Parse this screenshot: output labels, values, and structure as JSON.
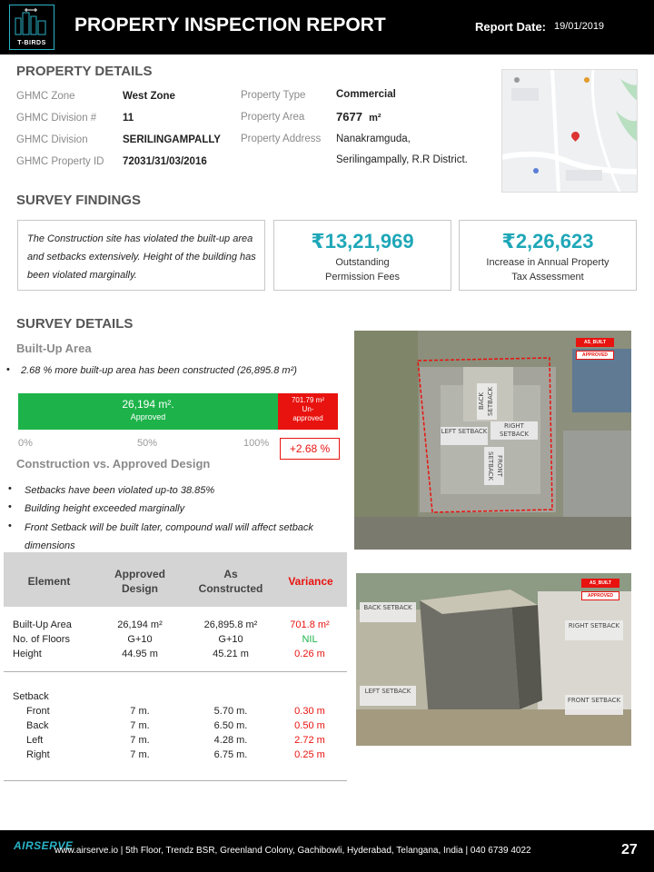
{
  "header": {
    "logo_text": "T-BIRDS",
    "title": "PROPERTY INSPECTION REPORT",
    "report_date_label": "Report Date:",
    "report_date": "19/01/2019"
  },
  "property_details": {
    "title": "PROPERTY DETAILS",
    "ghmc_zone_label": "GHMC Zone",
    "ghmc_zone": "West Zone",
    "ghmc_division_no_label": "GHMC Division  #",
    "ghmc_division_no": "11",
    "ghmc_division_label": "GHMC Division",
    "ghmc_division": "SERILINGAMPALLY",
    "ghmc_property_id_label": "GHMC Property ID",
    "ghmc_property_id": "72031/31/03/2016",
    "property_type_label": "Property Type",
    "property_type": "Commercial",
    "property_area_label": "Property Area",
    "property_area": "7677",
    "property_area_unit": "m²",
    "property_address_label": "Property Address",
    "property_address_line1": "Nanakramguda,",
    "property_address_line2": "Serilingampally, R.R District."
  },
  "survey_findings": {
    "title": "SURVEY FINDINGS",
    "summary": "The Construction site has violated the built-up area and setbacks extensively.  Height of the building has been violated marginally.",
    "outstanding_fees": "₹13,21,969",
    "outstanding_fees_caption_line1": "Outstanding",
    "outstanding_fees_caption_line2": "Permission Fees",
    "tax_increase": "₹2,26,623",
    "tax_increase_caption_line1": "Increase in Annual Property",
    "tax_increase_caption_line2": "Tax Assessment"
  },
  "survey_details": {
    "title": "SURVEY DETAILS",
    "built_up_title": "Built-Up  Area",
    "built_up_bullet": "2.68 % more built-up area has been constructed  (26,895.8 m²)",
    "bar": {
      "approved_value": "26,194  m².",
      "approved_label": "Approved",
      "unapproved_value": "701.79 m²",
      "unapproved_label_line1": "Un-",
      "unapproved_label_line2": "approved",
      "approved_fraction": 0.974,
      "axis_0": "0%",
      "axis_50": "50%",
      "axis_100": "100%",
      "variance": "+2.68 %"
    },
    "construction_title": "Construction  vs. Approved Design",
    "bullets": [
      "Setbacks have been violated up-to 38.85%",
      "Building height exceeded marginally",
      "Front Setback will be built later, compound wall will affect setback",
      "dimensions"
    ]
  },
  "table": {
    "headers": {
      "element": "Element",
      "approved_line1": "Approved",
      "approved_line2": "Design",
      "as_line1": "As",
      "as_line2": "Constructed",
      "variance": "Variance"
    },
    "rows": [
      {
        "element": "Built-Up Area",
        "approved": "26,194 m²",
        "constructed": "26,895.8 m²",
        "variance": "701.8 m²"
      },
      {
        "element": "No. of Floors",
        "approved": "G+10",
        "constructed": "G+10",
        "variance": "NIL"
      },
      {
        "element": "Height",
        "approved": "44.95 m",
        "constructed": "45.21 m",
        "variance": "0.26 m"
      }
    ],
    "setback_label": "Setback",
    "setback_rows": [
      {
        "element": "Front",
        "approved": "7 m.",
        "constructed": "5.70 m.",
        "variance": "0.30 m"
      },
      {
        "element": "Back",
        "approved": "7 m.",
        "constructed": "6.50 m.",
        "variance": "0.50 m"
      },
      {
        "element": "Left",
        "approved": "7 m.",
        "constructed": "4.28 m.",
        "variance": "2.72 m"
      },
      {
        "element": "Right",
        "approved": "7 m.",
        "constructed": "6.75 m.",
        "variance": "0.25 m"
      }
    ]
  },
  "photo1": {
    "legend_as_built": "AS_BUILT",
    "legend_approved": "APPROVED",
    "back_setback": "BACK SETBACK",
    "left_setback": "LEFT SETBACK",
    "right_setback": "RIGHT SETBACK",
    "front_setback": "FRONT SETBACK"
  },
  "photo2": {
    "legend_as_built": "AS_BUILT",
    "legend_approved": "APPROVED",
    "back_setback": "BACK SETBACK",
    "right_setback": "RIGHT SETBACK",
    "left_setback": "LEFT SETBACK",
    "front_setback": "FRONT SETBACK"
  },
  "footer": {
    "logo": "AIRSERVE",
    "text": "www.airserve.io  |    5th Floor, Trendz BSR, Greenland Colony, Gachibowli, Hyderabad, Telangana, India    |    040 6739 4022",
    "page": "27"
  },
  "colors": {
    "accent": "#1fa7b8",
    "approved_green": "#1db34a",
    "violation_red": "#e8130f",
    "nil_green": "#1db34a"
  }
}
